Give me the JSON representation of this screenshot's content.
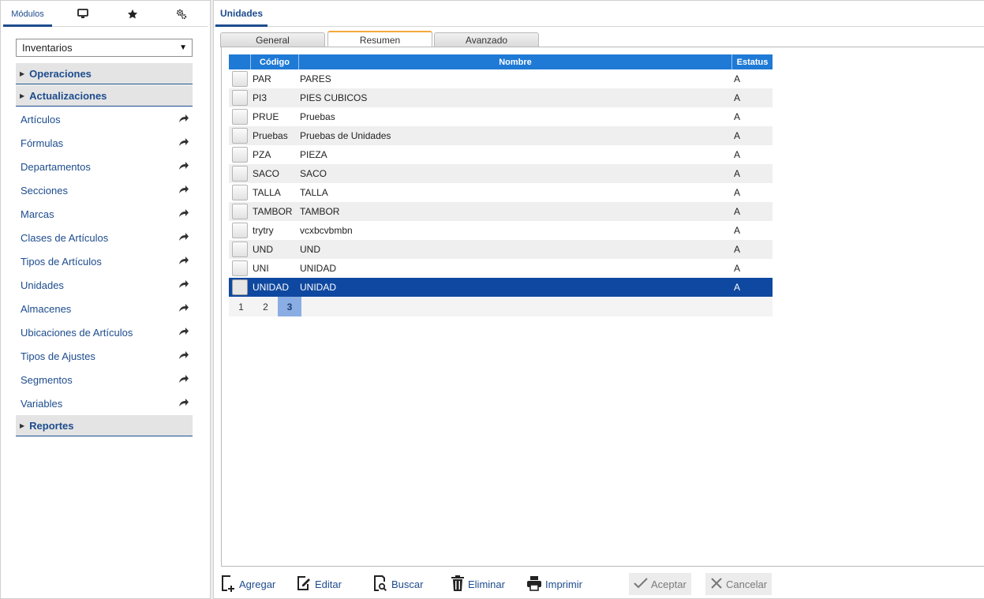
{
  "left_panel": {
    "tabs": [
      {
        "label": "Módulos",
        "icon": null
      },
      {
        "label": "",
        "icon": "monitor-icon"
      },
      {
        "label": "",
        "icon": "star-icon"
      },
      {
        "label": "",
        "icon": "settings-icon"
      }
    ],
    "module_select": {
      "value": "Inventarios"
    },
    "sections": {
      "operaciones": "Operaciones",
      "actualizaciones": "Actualizaciones",
      "reportes": "Reportes"
    },
    "menu_items": [
      "Artículos",
      "Fórmulas",
      "Departamentos",
      "Secciones",
      "Marcas",
      "Clases de Artículos",
      "Tipos de Artículos",
      "Unidades",
      "Almacenes",
      "Ubicaciones de Artículos",
      "Tipos de Ajustes",
      "Segmentos",
      "Variables"
    ]
  },
  "right_panel": {
    "title": "Unidades",
    "subtabs": [
      "General",
      "Resumen",
      "Avanzado"
    ],
    "active_subtab": "Resumen",
    "grid": {
      "columns": [
        "Código",
        "Nombre",
        "Estatus"
      ],
      "rows": [
        {
          "code": "PAR",
          "name": "PARES",
          "status": "A"
        },
        {
          "code": "PI3",
          "name": "PIES CUBICOS",
          "status": "A"
        },
        {
          "code": "PRUE",
          "name": "Pruebas",
          "status": "A"
        },
        {
          "code": "Pruebas",
          "name": "Pruebas de Unidades",
          "status": "A"
        },
        {
          "code": "PZA",
          "name": "PIEZA",
          "status": "A"
        },
        {
          "code": "SACO",
          "name": "SACO",
          "status": "A"
        },
        {
          "code": "TALLA",
          "name": "TALLA",
          "status": "A"
        },
        {
          "code": "TAMBOR",
          "name": "TAMBOR",
          "status": "A"
        },
        {
          "code": "trytry",
          "name": "vcxbcvbmbn",
          "status": "A"
        },
        {
          "code": "UND",
          "name": "UND",
          "status": "A"
        },
        {
          "code": "UNI",
          "name": "UNIDAD",
          "status": "A"
        },
        {
          "code": "UNIDAD",
          "name": "UNIDAD",
          "status": "A"
        }
      ],
      "selected_row": 11,
      "pages": [
        "1",
        "2",
        "3"
      ],
      "current_page": "3"
    },
    "toolbar": {
      "agregar": "Agregar",
      "editar": "Editar",
      "buscar": "Buscar",
      "eliminar": "Eliminar",
      "imprimir": "Imprimir",
      "aceptar": "Aceptar",
      "cancelar": "Cancelar"
    }
  },
  "colors": {
    "accent": "#1d4c8d",
    "grid_header": "#1f7ad6",
    "selected_row": "#0f48a0",
    "active_tab_top": "#f3a83b"
  }
}
